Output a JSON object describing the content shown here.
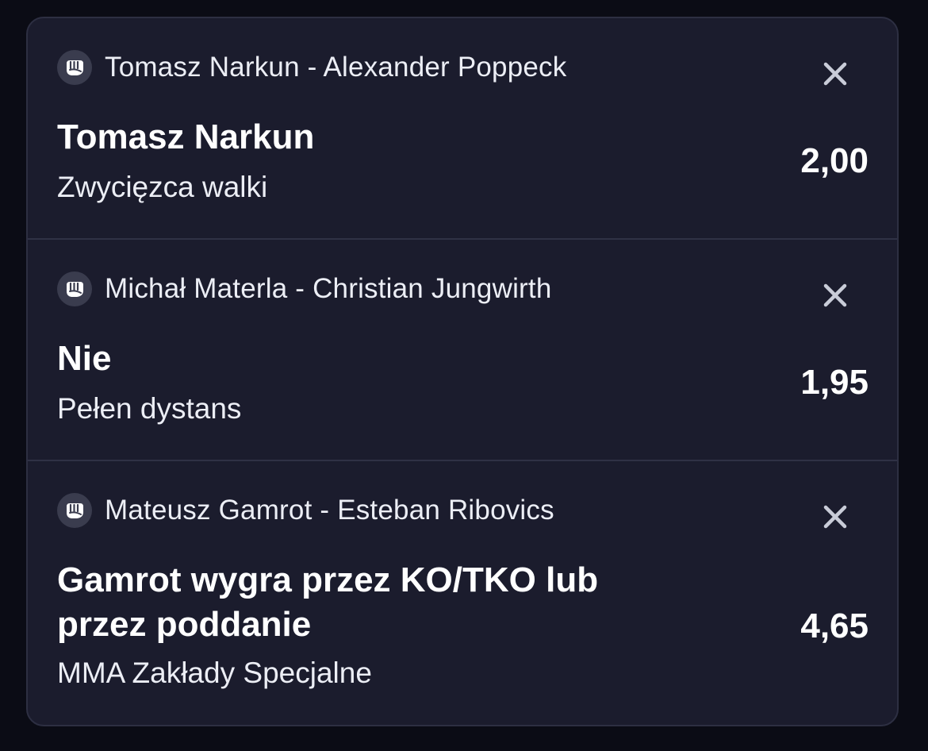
{
  "bets": [
    {
      "event": "Tomasz Narkun - Alexander Poppeck",
      "selection": "Tomasz Narkun",
      "market": "Zwycięzca walki",
      "odds": "2,00",
      "sport_icon": "mma-fist-icon",
      "remove_icon": "close-icon"
    },
    {
      "event": "Michał Materla - Christian Jungwirth",
      "selection": "Nie",
      "market": "Pełen dystans",
      "odds": "1,95",
      "sport_icon": "mma-fist-icon",
      "remove_icon": "close-icon"
    },
    {
      "event": "Mateusz Gamrot - Esteban Ribovics",
      "selection": "Gamrot wygra przez KO/TKO lub przez poddanie",
      "market": "MMA Zakłady Specjalne",
      "odds": "4,65",
      "sport_icon": "mma-fist-icon",
      "remove_icon": "close-icon"
    }
  ],
  "colors": {
    "background": "#0b0c15",
    "card": "#1b1c2d",
    "divider": "#2f3145",
    "close_icon": "#c9ccd8",
    "icon_bg": "#3a3c4e"
  }
}
